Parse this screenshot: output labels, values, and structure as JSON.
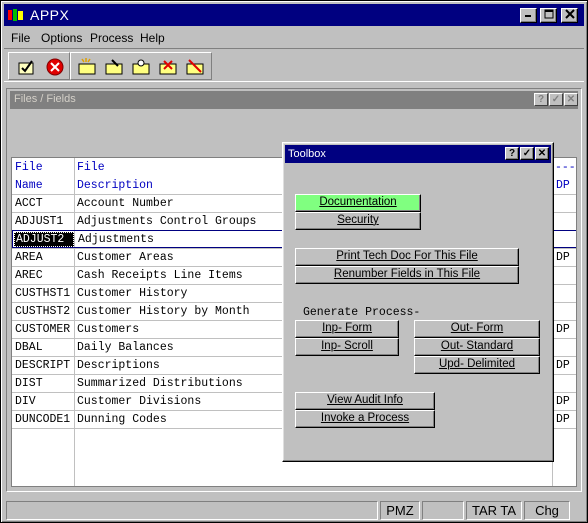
{
  "window": {
    "title": "APPX"
  },
  "menu": [
    "File",
    "Options",
    "Process",
    "Help"
  ],
  "subwindow": {
    "title": "Files / Fields"
  },
  "table": {
    "header_col1": [
      "File",
      "Name"
    ],
    "header_col2": [
      "File",
      "Description"
    ],
    "header_col3": [
      "---",
      "DP"
    ],
    "rows": [
      {
        "name": "ACCT",
        "desc": "Account Number",
        "dp": ""
      },
      {
        "name": "ADJUST1",
        "desc": "Adjustments Control Groups",
        "dp": ""
      },
      {
        "name": "ADJUST2",
        "desc": "Adjustments",
        "dp": ""
      },
      {
        "name": "AREA",
        "desc": "Customer Areas",
        "dp": "DP"
      },
      {
        "name": "AREC",
        "desc": "Cash Receipts Line Items",
        "dp": ""
      },
      {
        "name": "CUSTHST1",
        "desc": "Customer History",
        "dp": ""
      },
      {
        "name": "CUSTHST2",
        "desc": "Customer History by Month",
        "dp": ""
      },
      {
        "name": "CUSTOMER",
        "desc": "Customers",
        "dp": "DP"
      },
      {
        "name": "DBAL",
        "desc": "Daily Balances",
        "dp": ""
      },
      {
        "name": "DESCRIPT",
        "desc": "Descriptions",
        "dp": "DP"
      },
      {
        "name": "DIST",
        "desc": "Summarized Distributions",
        "dp": ""
      },
      {
        "name": "DIV",
        "desc": "Customer Divisions",
        "dp": "DP"
      },
      {
        "name": "DUNCODE1",
        "desc": "Dunning Codes",
        "dp": "DP"
      }
    ]
  },
  "toolbox": {
    "title": "Toolbox",
    "documentation": "Documentation",
    "security": "Security",
    "print_tech_doc": "Print Tech Doc For This File",
    "renumber_fields": "Renumber Fields in This File",
    "generate_label": "Generate Process-",
    "inp_form": "Inp- Form",
    "inp_scroll": "Inp- Scroll",
    "out_form": "Out- Form",
    "out_standard": "Out- Standard",
    "upd_delimited": "Upd- Delimited",
    "view_audit": "View Audit Info",
    "invoke_process": "Invoke a Process"
  },
  "status": {
    "pmz": "PMZ",
    "tar": "TAR TA",
    "chg": "Chg"
  },
  "colors": {
    "title_bg": "#000080",
    "header_text": "#0000c0",
    "doc_button": "#80ff80"
  }
}
